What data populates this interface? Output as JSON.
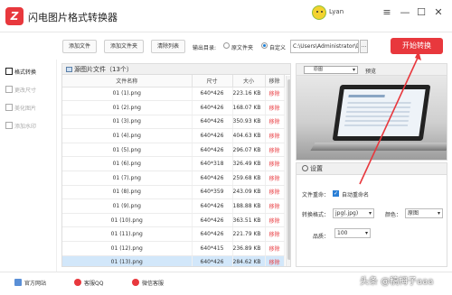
{
  "app": {
    "title": "闪电图片格式转换器",
    "logo_letter": "Z",
    "user": "Lyan"
  },
  "window": {
    "menu_glyph": "≡",
    "minimize_glyph": "—",
    "maximize_glyph": "☐",
    "close_glyph": "✕"
  },
  "toolbar": {
    "add_file": "添加文件",
    "add_folder": "添加文件夹",
    "clear_list": "清除列表",
    "output_dir_label": "输出目录:",
    "source_dir": "原文件夹",
    "custom": "自定义",
    "output_path": "C:\\Users\\Administrator\\De",
    "browse": "...",
    "start": "开始转换"
  },
  "sidebar": {
    "items": [
      {
        "label": "格式转换"
      },
      {
        "label": "更改尺寸"
      },
      {
        "label": "美化图片"
      },
      {
        "label": "添加水印"
      }
    ]
  },
  "file_list": {
    "header": "源图片文件（13个）",
    "columns": [
      "文件名称",
      "尺寸",
      "大小",
      "移除"
    ],
    "rows": [
      {
        "name": "01 (1).png",
        "dims": "640*426",
        "size": "223.16 KB",
        "action": "移除"
      },
      {
        "name": "01 (2).png",
        "dims": "640*426",
        "size": "168.07 KB",
        "action": "移除"
      },
      {
        "name": "01 (3).png",
        "dims": "640*426",
        "size": "350.93 KB",
        "action": "移除"
      },
      {
        "name": "01 (4).png",
        "dims": "640*426",
        "size": "404.63 KB",
        "action": "移除"
      },
      {
        "name": "01 (5).png",
        "dims": "640*426",
        "size": "296.07 KB",
        "action": "移除"
      },
      {
        "name": "01 (6).png",
        "dims": "640*318",
        "size": "326.49 KB",
        "action": "移除"
      },
      {
        "name": "01 (7).png",
        "dims": "640*426",
        "size": "259.68 KB",
        "action": "移除"
      },
      {
        "name": "01 (8).png",
        "dims": "640*359",
        "size": "243.09 KB",
        "action": "移除"
      },
      {
        "name": "01 (9).png",
        "dims": "640*426",
        "size": "188.88 KB",
        "action": "移除"
      },
      {
        "name": "01 (10).png",
        "dims": "640*426",
        "size": "363.51 KB",
        "action": "移除"
      },
      {
        "name": "01 (11).png",
        "dims": "640*426",
        "size": "221.79 KB",
        "action": "移除"
      },
      {
        "name": "01 (12).png",
        "dims": "640*415",
        "size": "236.89 KB",
        "action": "移除"
      },
      {
        "name": "01 (13).png",
        "dims": "640*426",
        "size": "284.62 KB",
        "action": "移除"
      }
    ]
  },
  "preview": {
    "mode": "原图",
    "label": "预览"
  },
  "settings": {
    "title": "设置",
    "rename_label": "文件重命：",
    "auto_rename": "自动重命名",
    "format_label": "转换格式：",
    "format_value": "jpg(.jpg)",
    "color_label": "颜色：",
    "color_value": "原图",
    "quality_label": "品质：",
    "quality_value": "100"
  },
  "footer": {
    "website": "官方网站",
    "qq": "客服QQ",
    "wechat": "微信客服"
  },
  "watermark": "头条 @稿栂子aaa",
  "colors": {
    "brand_red": "#e8383d",
    "selection_blue": "#d2e7fa",
    "link_blue": "#1a7fd6"
  },
  "icons": {
    "window_menu": "hamburger-icon",
    "minimize": "minimize-icon",
    "maximize": "maximize-icon",
    "close": "close-icon"
  }
}
